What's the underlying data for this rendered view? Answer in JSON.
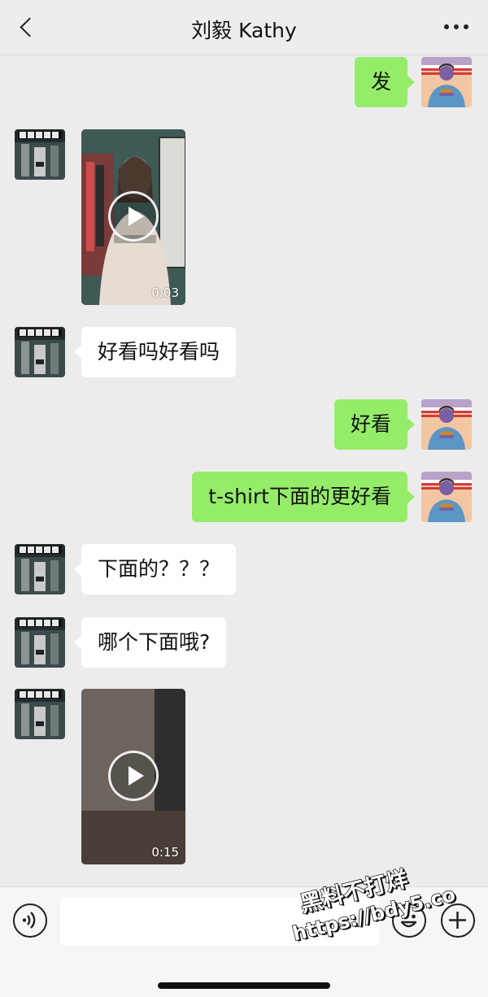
{
  "header": {
    "title": "刘毅 Kathy"
  },
  "icons": {
    "back": "chevron-left-icon",
    "more": "more-horizontal-icon",
    "voice": "voice-icon",
    "emoji": "emoji-icon",
    "plus": "plus-icon",
    "play": "play-icon"
  },
  "colors": {
    "outgoing_bubble": "#95ec69",
    "incoming_bubble": "#ffffff",
    "chat_background": "#ececec",
    "input_bar": "#f6f6f6"
  },
  "messages": [
    {
      "sender": "self",
      "type": "text",
      "text": "发"
    },
    {
      "sender": "contact",
      "type": "video",
      "duration": "0:03"
    },
    {
      "sender": "contact",
      "type": "text",
      "text": "好看吗好看吗"
    },
    {
      "sender": "self",
      "type": "text",
      "text": "好看"
    },
    {
      "sender": "self",
      "type": "text",
      "text": "t-shirt下面的更好看"
    },
    {
      "sender": "contact",
      "type": "text",
      "text": "下面的？？？"
    },
    {
      "sender": "contact",
      "type": "text",
      "text": "哪个下面哦?"
    },
    {
      "sender": "contact",
      "type": "video",
      "duration": "0:15"
    }
  ],
  "input": {
    "value": "",
    "placeholder": ""
  },
  "watermark": {
    "line1": "黑料不打烊",
    "line2": "https://bdy5.co"
  }
}
